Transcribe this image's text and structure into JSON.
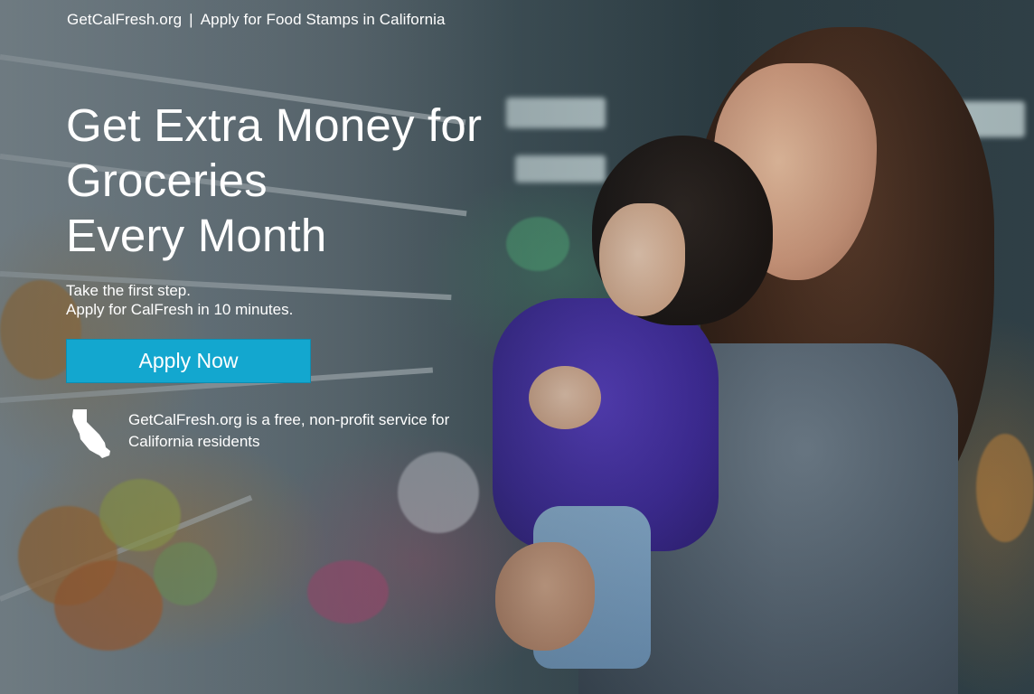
{
  "topbar": {
    "site_name": "GetCalFresh.org",
    "separator": "|",
    "tagline": "Apply for Food Stamps in California"
  },
  "hero": {
    "headline_lines": [
      "Get Extra Money for",
      "Groceries",
      "Every Month"
    ],
    "subtext_lines": [
      "Take the first step.",
      "Apply for CalFresh in 10 minutes."
    ],
    "cta_label": "Apply Now",
    "note": "GetCalFresh.org is a free, non-profit service for California residents",
    "note_icon": "california-state-icon"
  },
  "colors": {
    "cta": "#13a7cf",
    "text": "#ffffff"
  }
}
